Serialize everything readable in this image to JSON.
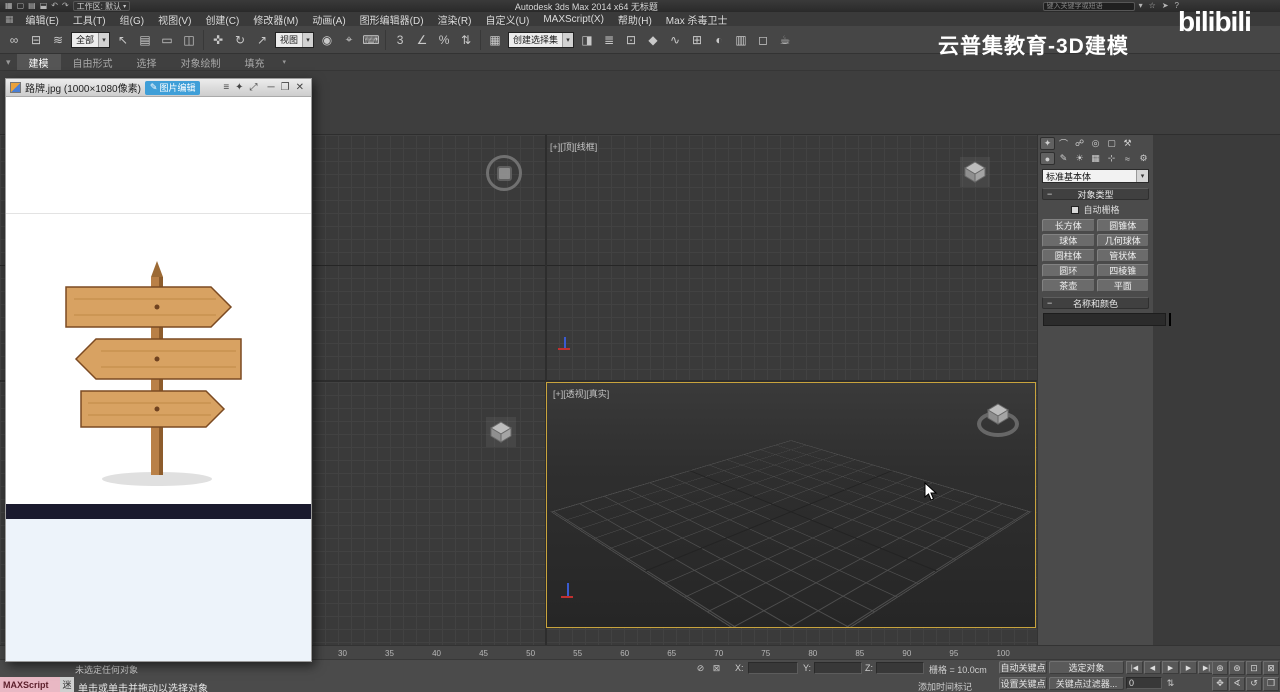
{
  "titlebar": {
    "qat_icons": [
      {
        "n": "app-menu-icon",
        "g": "▦"
      },
      {
        "n": "new-scene-icon",
        "g": "▢"
      },
      {
        "n": "open-file-icon",
        "g": "▤"
      },
      {
        "n": "save-file-icon",
        "g": "⬓"
      },
      {
        "n": "undo-icon",
        "g": "↶"
      },
      {
        "n": "redo-icon",
        "g": "↷"
      }
    ],
    "workspace_label": "工作区: 默认",
    "title": "Autodesk 3ds Max  2014 x64  无标题",
    "search_placeholder": "键入关键字或短语",
    "right_icons": [
      {
        "n": "search-arrow-icon",
        "g": "▾"
      },
      {
        "n": "favorites-star-icon",
        "g": "☆"
      },
      {
        "n": "communication-icon",
        "g": "➤"
      },
      {
        "n": "help-icon",
        "g": "?"
      }
    ]
  },
  "menubar": {
    "items": [
      "编辑(E)",
      "工具(T)",
      "组(G)",
      "视图(V)",
      "创建(C)",
      "修改器(M)",
      "动画(A)",
      "图形编辑器(D)",
      "渲染(R)",
      "自定义(U)",
      "MAXScript(X)",
      "帮助(H)",
      "Max 杀毒卫士"
    ]
  },
  "toolbar": {
    "items": [
      {
        "t": "i",
        "n": "select-and-link-icon",
        "g": "∞"
      },
      {
        "t": "i",
        "n": "unlink-selection-icon",
        "g": "⊟"
      },
      {
        "t": "i",
        "n": "bind-to-space-warp-icon",
        "g": "≋"
      },
      {
        "t": "d",
        "n": "selection-filter-dropdown",
        "label": "全部"
      },
      {
        "t": "i",
        "n": "select-object-icon",
        "g": "↖"
      },
      {
        "t": "i",
        "n": "select-by-name-icon",
        "g": "▤"
      },
      {
        "t": "i",
        "n": "rectangular-selection-region-icon",
        "g": "▭"
      },
      {
        "t": "i",
        "n": "window-crossing-icon",
        "g": "◫"
      },
      {
        "t": "s"
      },
      {
        "t": "i",
        "n": "select-and-move-icon",
        "g": "✜"
      },
      {
        "t": "i",
        "n": "select-and-rotate-icon",
        "g": "↻"
      },
      {
        "t": "i",
        "n": "select-and-scale-icon",
        "g": "↗"
      },
      {
        "t": "d",
        "n": "reference-coordinate-dropdown",
        "label": "视图"
      },
      {
        "t": "i",
        "n": "use-pivot-center-icon",
        "g": "◉"
      },
      {
        "t": "i",
        "n": "select-and-manipulate-icon",
        "g": "⌖"
      },
      {
        "t": "i",
        "n": "keyboard-override-icon",
        "g": "⌨"
      },
      {
        "t": "s"
      },
      {
        "t": "i",
        "n": "snap-toggle-3d-icon",
        "g": "3"
      },
      {
        "t": "i",
        "n": "angle-snap-icon",
        "g": "∠"
      },
      {
        "t": "i",
        "n": "percent-snap-icon",
        "g": "%"
      },
      {
        "t": "i",
        "n": "spinner-snap-icon",
        "g": "⇅"
      },
      {
        "t": "s"
      },
      {
        "t": "i",
        "n": "edit-named-selection-icon",
        "g": "▦"
      },
      {
        "t": "d",
        "n": "named-selection-dropdown",
        "label": "创建选择集"
      },
      {
        "t": "i",
        "n": "mirror-icon",
        "g": "◨"
      },
      {
        "t": "i",
        "n": "align-icon",
        "g": "≣"
      },
      {
        "t": "i",
        "n": "layer-manager-icon",
        "g": "⊡"
      },
      {
        "t": "i",
        "n": "graphite-toggle-icon",
        "g": "◆"
      },
      {
        "t": "i",
        "n": "curve-editor-icon",
        "g": "∿"
      },
      {
        "t": "i",
        "n": "schematic-view-icon",
        "g": "⊞"
      },
      {
        "t": "i",
        "n": "material-editor-icon",
        "g": "◐"
      },
      {
        "t": "i",
        "n": "render-setup-icon",
        "g": "▥"
      },
      {
        "t": "i",
        "n": "rendered-frame-icon",
        "g": "◻"
      },
      {
        "t": "i",
        "n": "render-production-icon",
        "g": "☕"
      }
    ]
  },
  "ribbon": {
    "tabs": [
      {
        "id": "modeling",
        "label": "建模",
        "active": true
      },
      {
        "id": "freeform",
        "label": "自由形式",
        "active": false
      },
      {
        "id": "selection",
        "label": "选择",
        "active": false
      },
      {
        "id": "object-paint",
        "label": "对象绘制",
        "active": false
      },
      {
        "id": "populate",
        "label": "填充",
        "active": false
      }
    ],
    "arrow": "▾"
  },
  "image_window": {
    "title": "路牌.jpg (1000×1080像素)",
    "edit_icon": "✎",
    "edit_button_label": "图片编辑",
    "mid_icons": [
      {
        "n": "menu-icon",
        "g": "≡"
      },
      {
        "n": "pin-icon",
        "g": "✦"
      },
      {
        "n": "fullscreen-icon",
        "g": "⤢"
      }
    ],
    "window_controls": [
      {
        "n": "minimize-button",
        "g": "─"
      },
      {
        "n": "restore-button",
        "g": "❐"
      },
      {
        "n": "close-button",
        "g": "✕"
      }
    ]
  },
  "viewports": {
    "top_label": "[+][顶][线框]",
    "persp_label": "[+][透视][真实]",
    "active_border_color": "#c9a43d"
  },
  "command_panel": {
    "tabs": [
      {
        "n": "create-tab",
        "g": "✦",
        "active": true
      },
      {
        "n": "modify-tab",
        "g": "⌒",
        "active": false
      },
      {
        "n": "hierarchy-tab",
        "g": "☍",
        "active": false
      },
      {
        "n": "motion-tab",
        "g": "◎",
        "active": false
      },
      {
        "n": "display-tab",
        "g": "▢",
        "active": false
      },
      {
        "n": "utilities-tab",
        "g": "⚒",
        "active": false
      }
    ],
    "subtabs": [
      {
        "n": "geometry-category",
        "g": "●",
        "active": true
      },
      {
        "n": "shapes-category",
        "g": "✎",
        "active": false
      },
      {
        "n": "lights-category",
        "g": "☀",
        "active": false
      },
      {
        "n": "cameras-category",
        "g": "▦",
        "active": false
      },
      {
        "n": "helpers-category",
        "g": "⊹",
        "active": false
      },
      {
        "n": "space-warps-category",
        "g": "≈",
        "active": false
      },
      {
        "n": "systems-category",
        "g": "⚙",
        "active": false
      }
    ],
    "category_dropdown": "标准基本体",
    "rollout_collapse_glyph": "−",
    "object_type_rollout": "对象类型",
    "autogrid_label": "自动栅格",
    "object_buttons": [
      {
        "n": "box",
        "label": "长方体"
      },
      {
        "n": "cone",
        "label": "圆锥体"
      },
      {
        "n": "sphere",
        "label": "球体"
      },
      {
        "n": "geosphere",
        "label": "几何球体"
      },
      {
        "n": "cylinder",
        "label": "圆柱体"
      },
      {
        "n": "tube",
        "label": "管状体"
      },
      {
        "n": "torus",
        "label": "圆环"
      },
      {
        "n": "pyramid",
        "label": "四棱锥"
      },
      {
        "n": "teapot",
        "label": "茶壶"
      },
      {
        "n": "plane",
        "label": "平面"
      }
    ],
    "name_color_rollout": "名称和颜色",
    "object_name_value": ""
  },
  "timeline": {
    "ticks": [
      "30",
      "35",
      "40",
      "45",
      "50",
      "55",
      "60",
      "65",
      "70",
      "75",
      "80",
      "85",
      "90",
      "95",
      "100"
    ]
  },
  "statusbar": {
    "prompt_line": "未选定任何对象",
    "status_line": "单击或单击并拖动以选择对象",
    "maxscript_label": "MAXScript",
    "mini_listener_label": "迷",
    "isolate_icon": "⊘",
    "lock_icon": "⊠",
    "x_label": "X:",
    "y_label": "Y:",
    "z_label": "Z:",
    "x_value": "",
    "y_value": "",
    "z_value": "",
    "grid_label": "栅格 = 10.0cm",
    "add_time_tag": "添加时间标记",
    "auto_key_label": "自动关键点",
    "set_key_label": "设置关键点",
    "selected_filter_label": "选定对象",
    "key_filters_label": "关键点过滤器...",
    "frame_value": "0",
    "spinner_glyph": "⇅",
    "playback": [
      {
        "n": "go-to-start-button",
        "g": "|◀"
      },
      {
        "n": "previous-frame-button",
        "g": "◀"
      },
      {
        "n": "play-button",
        "g": "▶"
      },
      {
        "n": "next-frame-button",
        "g": "▶"
      },
      {
        "n": "go-to-end-button",
        "g": "▶|"
      }
    ],
    "nav_buttons": [
      {
        "n": "zoom-icon",
        "g": "⊕"
      },
      {
        "n": "zoom-all-icon",
        "g": "⊛"
      },
      {
        "n": "zoom-extents-icon",
        "g": "⊡"
      },
      {
        "n": "zoom-extents-all-icon",
        "g": "⊠"
      },
      {
        "n": "pan-icon",
        "g": "✥"
      },
      {
        "n": "field-of-view-icon",
        "g": "∢"
      },
      {
        "n": "orbit-icon",
        "g": "↺"
      },
      {
        "n": "maximize-viewport-icon",
        "g": "❒"
      }
    ]
  },
  "branding": {
    "watermark": "云普集教育-3D建模",
    "logo": "bilibili"
  },
  "glyphs": {
    "dropdown_arrow": "▾"
  }
}
